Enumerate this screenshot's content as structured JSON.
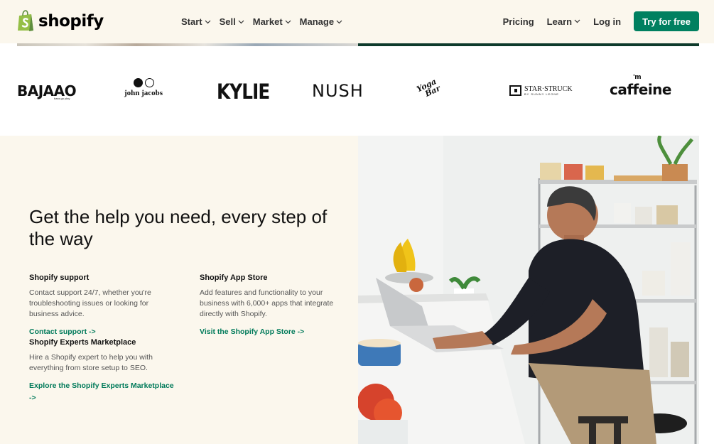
{
  "header": {
    "logo_text": "shopify",
    "nav": [
      {
        "label": "Start"
      },
      {
        "label": "Sell"
      },
      {
        "label": "Market"
      },
      {
        "label": "Manage"
      }
    ],
    "pricing": "Pricing",
    "learn": "Learn",
    "login": "Log in",
    "cta": "Try for free",
    "colors": {
      "accent": "#008060",
      "background": "#fbf7ed"
    }
  },
  "brands": {
    "bajaao": "BAJAAO",
    "bajaao_sub": "bass go play",
    "john_jacobs": "john jacobs",
    "kylie": "KYLIE",
    "nush": "NUSH",
    "yoga_1": "Yoga",
    "yoga_2": "Bar",
    "star_struck": "STAR·STRUCK",
    "star_struck_sub": "BY SUNNY LEONE",
    "caffeine": "caffeine",
    "caffeine_m": "'m"
  },
  "help": {
    "title": "Get the help you need, every step of the way",
    "support": {
      "heading": "Shopify support",
      "text": "Contact support 24/7, whether you're troubleshooting issues or looking for business advice.",
      "link": "Contact support ->"
    },
    "app_store": {
      "heading": "Shopify App Store",
      "text": "Add features and functionality to your business with 6,000+ apps that integrate directly with Shopify.",
      "link": "Visit the Shopify App Store ->"
    },
    "experts": {
      "heading": "Shopify Experts Marketplace",
      "text": "Hire a Shopify expert to help you with everything from store setup to SEO.",
      "link": "Explore the Shopify Experts Marketplace ->"
    }
  }
}
